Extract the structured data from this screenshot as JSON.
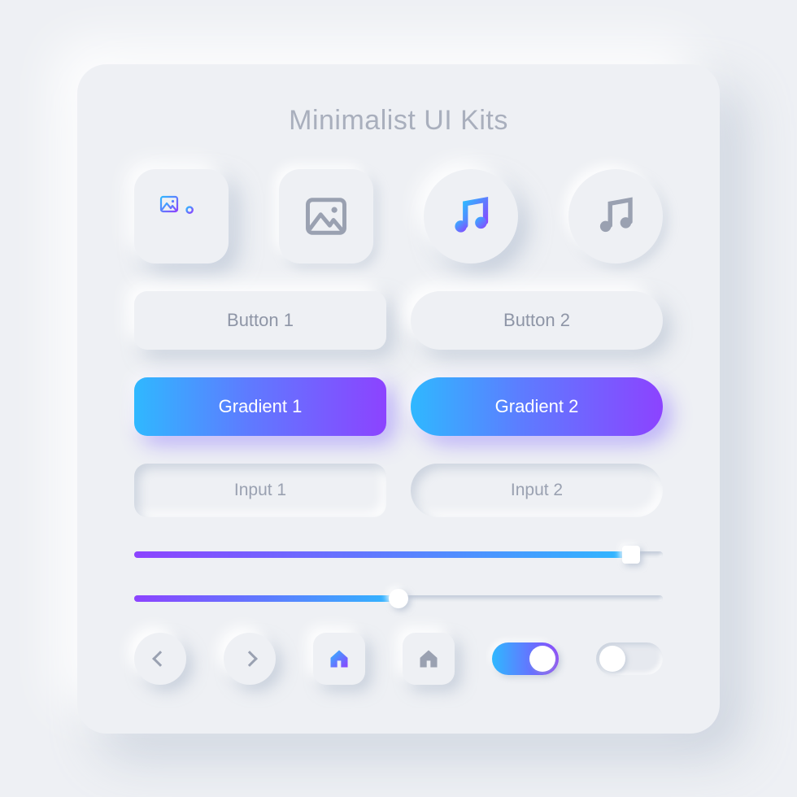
{
  "title": "Minimalist UI Kits",
  "colors": {
    "grad_start": "#2FB8FF",
    "grad_mid": "#5E7BFF",
    "grad_end": "#8C43FF",
    "muted": "#9AA1B1"
  },
  "icons": {
    "image_gradient": "image-icon",
    "image_muted": "image-icon",
    "music_gradient": "music-icon",
    "music_muted": "music-icon"
  },
  "buttons": {
    "b1": "Button 1",
    "b2": "Button 2",
    "g1": "Gradient 1",
    "g2": "Gradient 2"
  },
  "inputs": {
    "i1_placeholder": "Input 1",
    "i2_placeholder": "Input 2"
  },
  "sliders": {
    "s1_value": 94,
    "s2_value": 50
  },
  "toggles": {
    "t1": true,
    "t2": false
  }
}
